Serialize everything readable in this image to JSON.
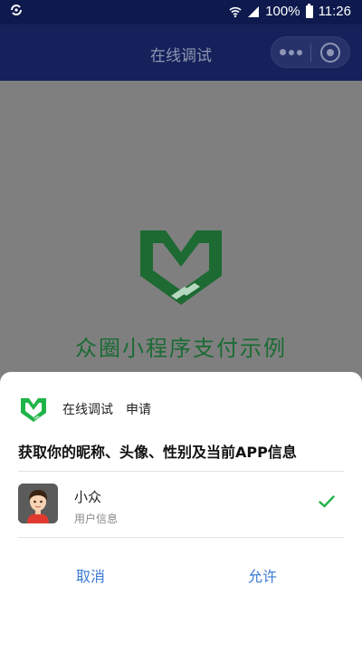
{
  "status_bar": {
    "left_icon": "sync-icon",
    "battery": "100%",
    "time": "11:26"
  },
  "nav": {
    "title": "在线调试"
  },
  "page": {
    "app_name": "众圈小程序支付示例"
  },
  "sheet": {
    "app_label": "在线调试",
    "apply_label": "申请",
    "description": "获取你的昵称、头像、性别及当前APP信息",
    "user": {
      "name": "小众",
      "subtitle": "用户信息"
    },
    "cancel_label": "取消",
    "allow_label": "允许"
  },
  "colors": {
    "accent_green": "#1fb449",
    "link_blue": "#3a7bd5",
    "nav_bg": "#15215a"
  }
}
